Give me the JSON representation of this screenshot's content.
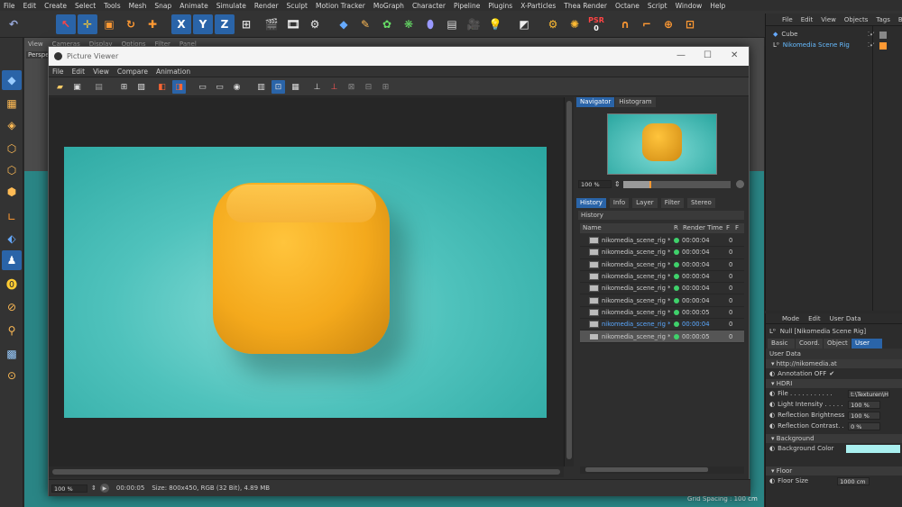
{
  "main_menu": [
    "File",
    "Edit",
    "Create",
    "Select",
    "Tools",
    "Mesh",
    "Snap",
    "Animate",
    "Simulate",
    "Render",
    "Sculpt",
    "Motion Tracker",
    "MoGraph",
    "Character",
    "Pipeline",
    "Plugins",
    "X-Particles",
    "Thea Render",
    "Octane",
    "Script",
    "Window",
    "Help"
  ],
  "viewport_menu": [
    "View",
    "Cameras",
    "Display",
    "Options",
    "Filter",
    "Panel"
  ],
  "viewport_label": "Perspe",
  "toolbar_letters": {
    "x": "X",
    "y": "Y",
    "z": "Z",
    "psr": "PSR",
    "psr_value": "0"
  },
  "object_manager": {
    "menu": [
      "File",
      "Edit",
      "View",
      "Objects",
      "Tags",
      "B"
    ],
    "items": [
      {
        "name": "Cube"
      },
      {
        "name": "Nikomedia Scene Rig"
      }
    ]
  },
  "attributes": {
    "menu": [
      "Mode",
      "Edit",
      "User Data"
    ],
    "object_label": "Null [Nikomedia Scene Rig]",
    "tabs": [
      "Basic",
      "Coord.",
      "Object",
      "User Data"
    ],
    "section": "User Data",
    "link_group": "http://nikomedia.at",
    "annotation": "Annotation OFF",
    "hdri_group": "HDRI",
    "file_label": "File . . . . . . . . . . .",
    "file_value": "t:\\Texturen\\HD",
    "light_intensity_label": "Light Intensity . . . . .",
    "light_intensity": "100 %",
    "reflection_brightness_label": "Reflection Brightness",
    "reflection_brightness": "100 %",
    "reflection_contrast_label": "Reflection Contrast. .",
    "reflection_contrast": "0 %",
    "background_group": "Background",
    "background_color_label": "Background Color",
    "background_color": "#aaf0f0",
    "floor_group": "Floor",
    "floor_size_label": "Floor Size",
    "floor_size": "1000 cm"
  },
  "picture_viewer": {
    "title": "Picture Viewer",
    "menu": [
      "File",
      "Edit",
      "View",
      "Compare",
      "Animation"
    ],
    "nav_tabs": [
      "Navigator",
      "Histogram"
    ],
    "zoom": "100 %",
    "tabs": [
      "History",
      "Info",
      "Layer",
      "Filter",
      "Stereo"
    ],
    "history_label": "History",
    "columns": [
      "Name",
      "R",
      "Render Time",
      "F",
      "F"
    ],
    "rows": [
      {
        "name": "nikomedia_scene_rig *",
        "time": "00:00:04",
        "frame": "0"
      },
      {
        "name": "nikomedia_scene_rig *",
        "time": "00:00:04",
        "frame": "0"
      },
      {
        "name": "nikomedia_scene_rig *",
        "time": "00:00:04",
        "frame": "0"
      },
      {
        "name": "nikomedia_scene_rig *",
        "time": "00:00:04",
        "frame": "0"
      },
      {
        "name": "nikomedia_scene_rig *",
        "time": "00:00:04",
        "frame": "0"
      },
      {
        "name": "nikomedia_scene_rig *",
        "time": "00:00:04",
        "frame": "0"
      },
      {
        "name": "nikomedia_scene_rig *",
        "time": "00:00:05",
        "frame": "0"
      },
      {
        "name": "nikomedia_scene_rig *",
        "time": "00:00:04",
        "frame": "0"
      },
      {
        "name": "nikomedia_scene_rig *",
        "time": "00:00:05",
        "frame": "0"
      }
    ],
    "status_zoom": "100 %",
    "status_time": "00:00:05",
    "status_info": "Size: 800x450, RGB (32 Bit), 4.89 MB"
  },
  "grid_spacing": "Grid Spacing : 100 cm",
  "colors": {
    "accent": "#2a64a8",
    "teal": "#2aa6a0",
    "cube": "#f4a91c"
  }
}
